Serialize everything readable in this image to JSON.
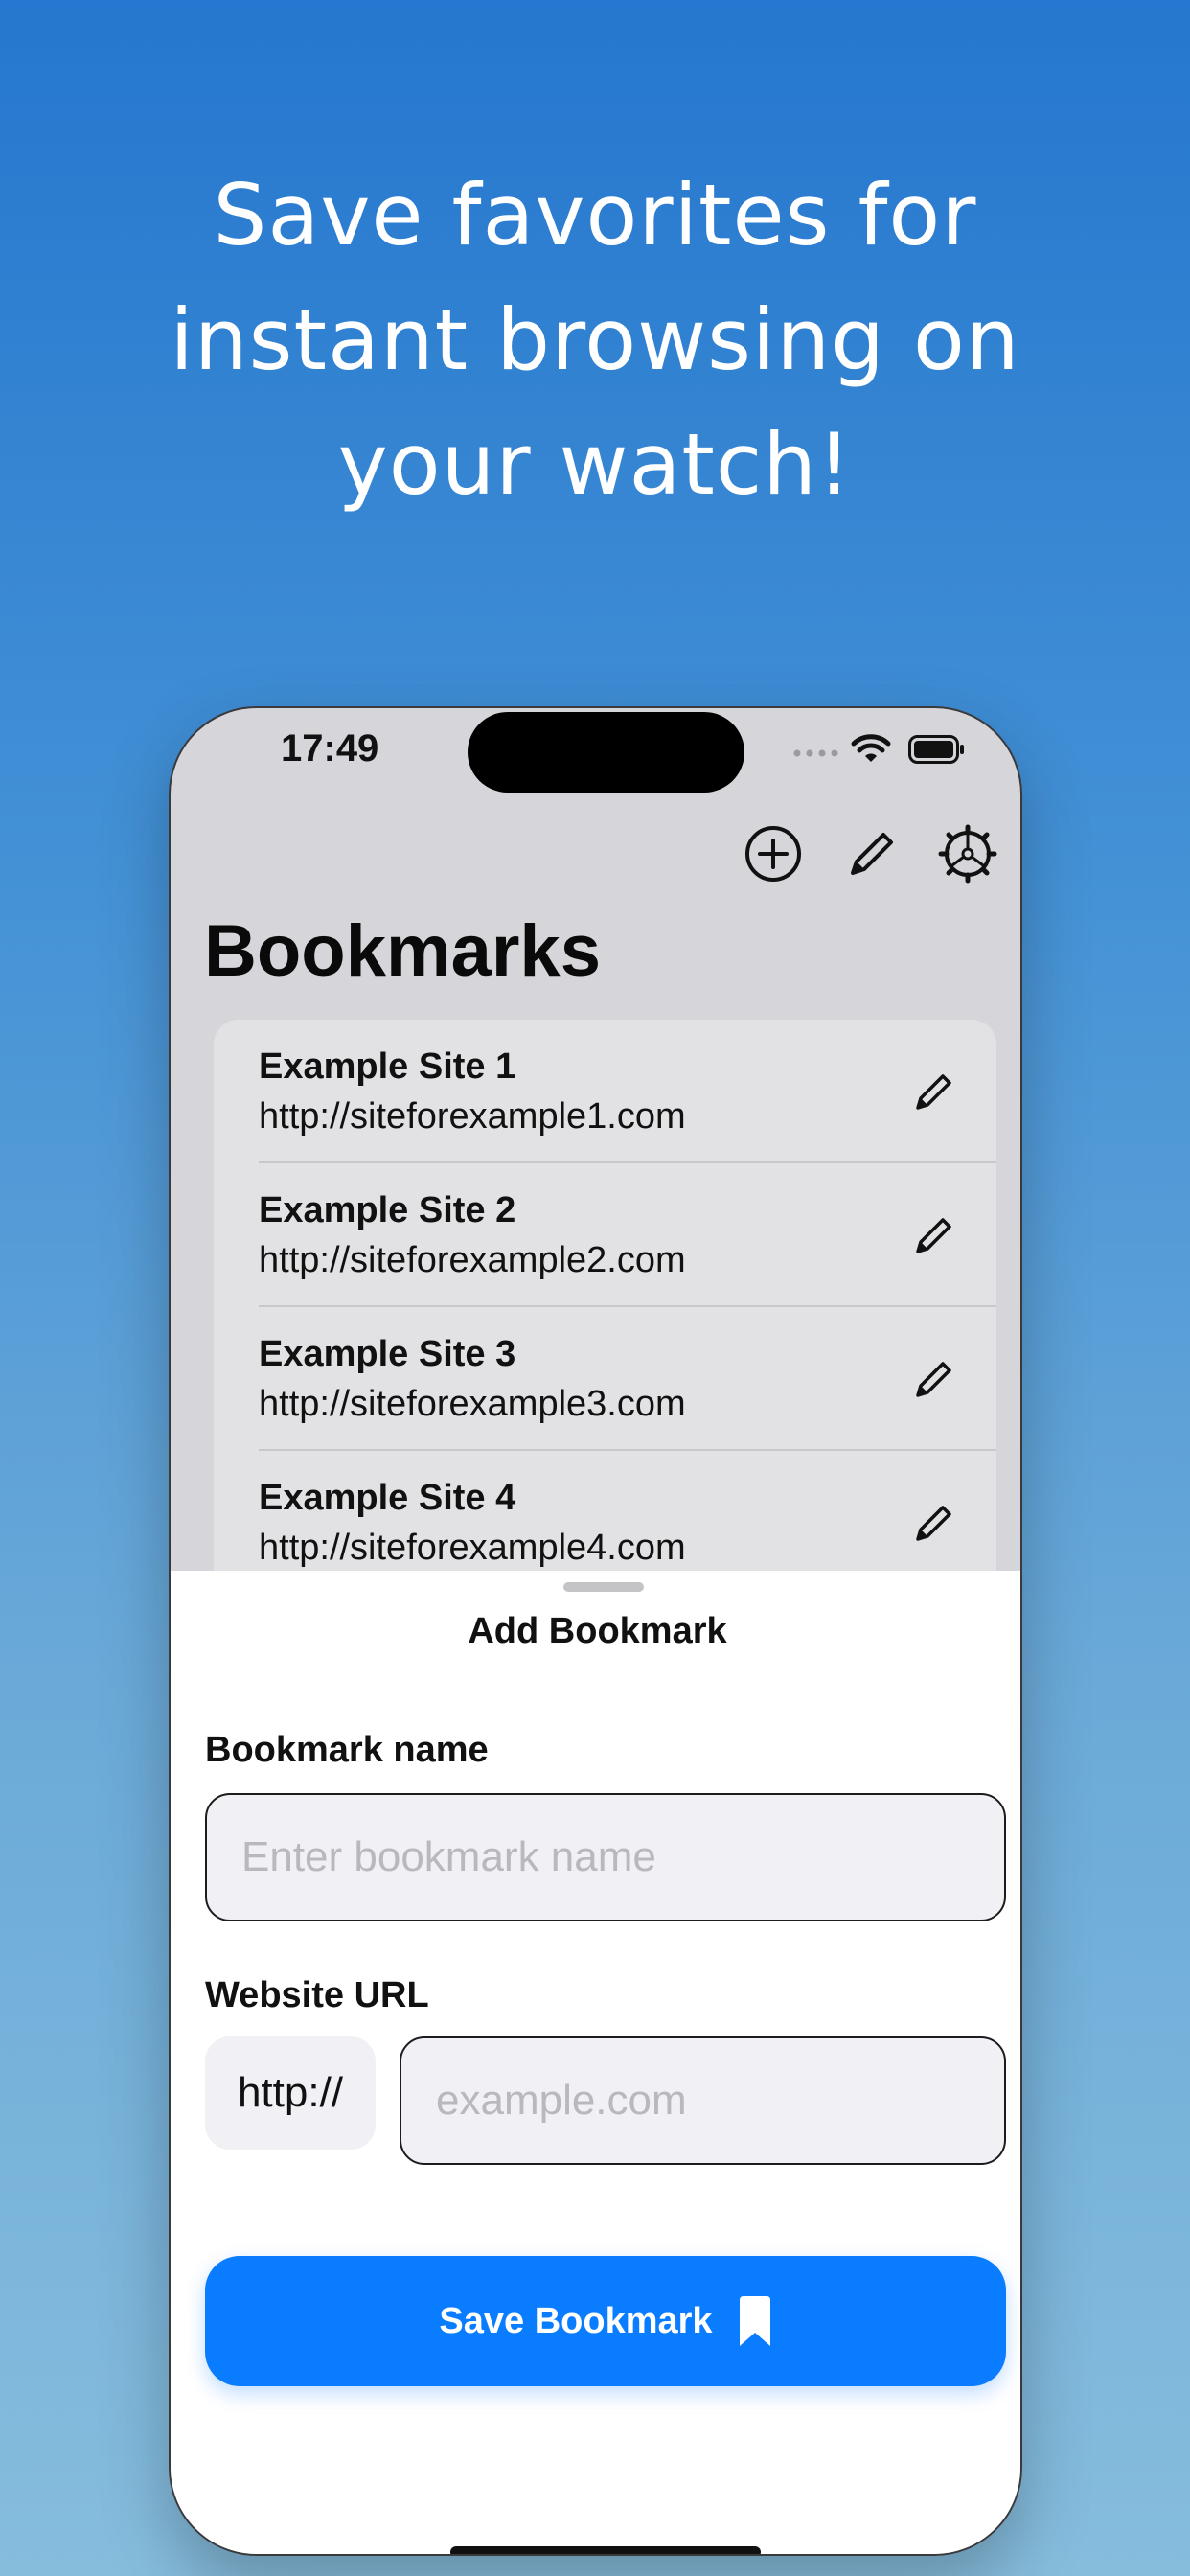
{
  "headline": {
    "line1": "Save favorites for",
    "line2": "instant browsing on",
    "line3": "your watch!"
  },
  "status_bar": {
    "time": "17:49"
  },
  "toolbar": {
    "add_icon": "plus-circle-icon",
    "edit_icon": "pencil-icon",
    "settings_icon": "gear-icon"
  },
  "page": {
    "title": "Bookmarks"
  },
  "bookmarks": [
    {
      "name": "Example Site 1",
      "url": "http://siteforexample1.com"
    },
    {
      "name": "Example Site 2",
      "url": "http://siteforexample2.com"
    },
    {
      "name": "Example Site 3",
      "url": "http://siteforexample3.com"
    },
    {
      "name": "Example Site 4",
      "url": "http://siteforexample4.com"
    }
  ],
  "sheet": {
    "title": "Add Bookmark",
    "name_label": "Bookmark name",
    "name_placeholder": "Enter bookmark name",
    "url_label": "Website URL",
    "url_prefix": "http://",
    "url_placeholder": "example.com",
    "save_label": "Save Bookmark",
    "save_icon": "bookmark-icon"
  },
  "colors": {
    "accent": "#0a7cff",
    "gradient_top": "#2577cf",
    "gradient_bottom": "#86bddd"
  }
}
